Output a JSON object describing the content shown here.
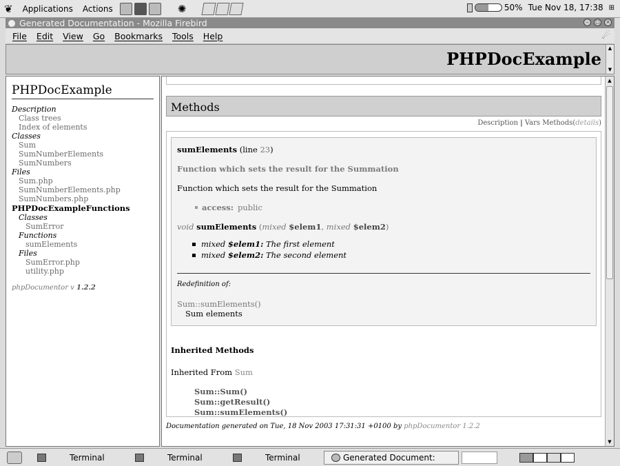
{
  "top_panel": {
    "menus": [
      "Applications",
      "Actions"
    ],
    "battery_percent": "50%",
    "battery_level": 0.5,
    "clock": "Tue Nov 18, 17:38"
  },
  "window": {
    "title": "Generated Documentation - Mozilla Firebird"
  },
  "menubar": {
    "items": [
      "File",
      "Edit",
      "View",
      "Go",
      "Bookmarks",
      "Tools",
      "Help"
    ]
  },
  "header": {
    "title": "PHPDocExample"
  },
  "nav": {
    "title": "PHPDocExample",
    "description_label": "Description",
    "class_trees": "Class trees",
    "index_of_elements": "Index of elements",
    "classes_label": "Classes",
    "classes": [
      "Sum",
      "SumNumberElements",
      "SumNumbers"
    ],
    "files_label": "Files",
    "files": [
      "Sum.php",
      "SumNumberElements.php",
      "SumNumbers.php"
    ],
    "subpackage": {
      "name": "PHPDocExampleFunctions",
      "classes_label": "Classes",
      "classes": [
        "SumError"
      ],
      "functions_label": "Functions",
      "functions": [
        "sumElements"
      ],
      "files_label": "Files",
      "files": [
        "SumError.php",
        "utility.php"
      ]
    },
    "footer_prefix": "phpDocumentor v",
    "footer_version": "1.2.2"
  },
  "main": {
    "methods_heading": "Methods",
    "methods_nav": {
      "description": "Description",
      "separator": "|",
      "vars": "Vars",
      "methods": "Methods",
      "details_open": "(",
      "details": "details",
      "details_close": ")"
    },
    "method": {
      "name": "sumElements",
      "line_prefix": "(line",
      "line_number": "23",
      "line_suffix": ")",
      "short_description": "Function which sets the result for the Summation",
      "long_description": "Function which sets the result for the Summation",
      "access_label": "access:",
      "access_value": "public",
      "return_type": "void",
      "signature_name": "sumElements",
      "sig_open": "(",
      "param1_type": "mixed",
      "param1_name": "$elem1",
      "sig_comma": ",",
      "param2_type": "mixed",
      "param2_name": "$elem2",
      "sig_close": ")",
      "params": [
        {
          "type": "mixed",
          "name": "$elem1:",
          "desc": "The first element"
        },
        {
          "type": "mixed",
          "name": "$elem2:",
          "desc": "The second element"
        }
      ],
      "redefinition_label": "Redefinition of:",
      "redefinition_link": "Sum::sumElements()",
      "redefinition_desc": "Sum elements"
    },
    "inherited_title": "Inherited Methods",
    "inherited_from_label": "Inherited From",
    "inherited_from_class": "Sum",
    "inherited_methods": [
      "Sum::Sum()",
      "Sum::getResult()",
      "Sum::sumElements()"
    ],
    "footer_text": "Documentation generated on Tue, 18 Nov 2003 17:31:31 +0100 by",
    "footer_link": "phpDocumentor 1.2.2"
  },
  "taskbar": {
    "tasks": [
      "Terminal",
      "Terminal",
      "Terminal",
      "Generated Document:"
    ]
  }
}
